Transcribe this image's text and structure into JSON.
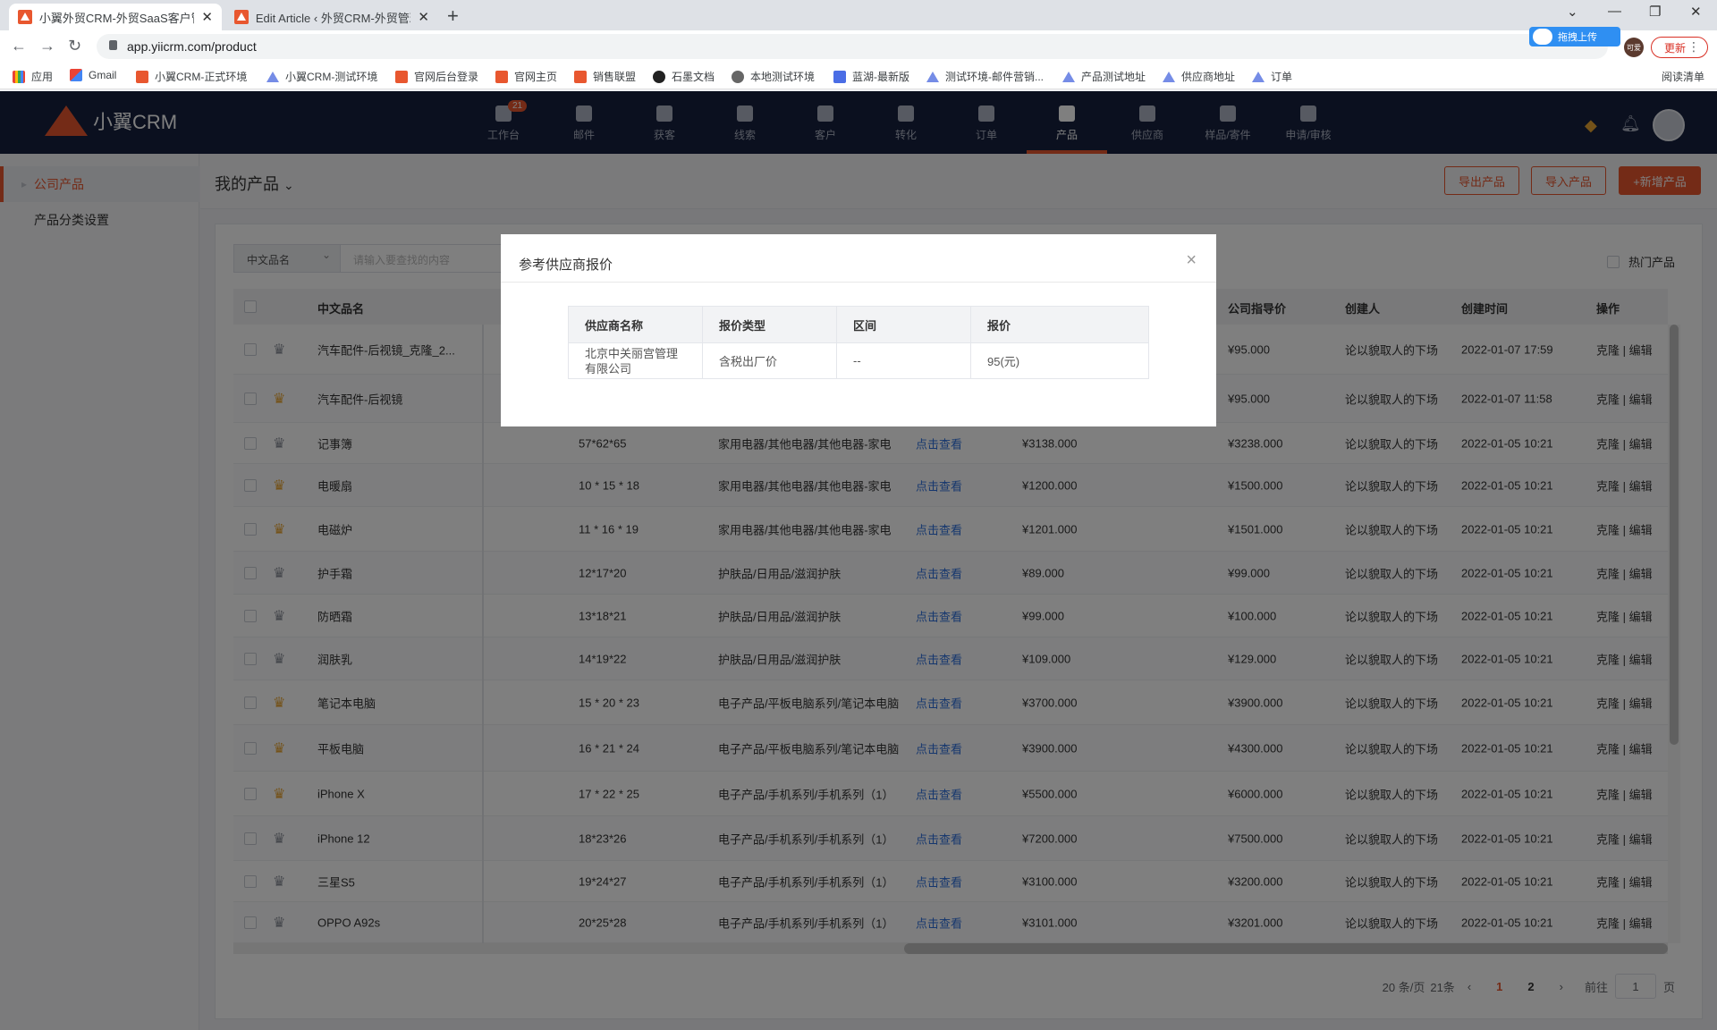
{
  "browser": {
    "tabs": [
      {
        "title": "小翼外贸CRM-外贸SaaS客户管理",
        "active": true
      },
      {
        "title": "Edit Article ‹ 外贸CRM-外贸管理",
        "active": false
      }
    ],
    "url": "app.yiicrm.com/product",
    "upload_label": "拖拽上传",
    "profile_label": "可爱",
    "update_label": "更新",
    "bookmarks": [
      "应用",
      "Gmail",
      "小翼CRM-正式环境",
      "小翼CRM-测试环境",
      "官网后台登录",
      "官网主页",
      "销售联盟",
      "石墨文档",
      "本地测试环境",
      "蓝湖-最新版",
      "测试环境-邮件营销...",
      "产品测试地址",
      "供应商地址",
      "订单"
    ],
    "reading_list": "阅读清单"
  },
  "app": {
    "logo": "小翼CRM",
    "nav": [
      {
        "label": "工作台",
        "badge": "21",
        "active": false
      },
      {
        "label": "邮件",
        "active": false
      },
      {
        "label": "获客",
        "active": false
      },
      {
        "label": "线索",
        "active": false
      },
      {
        "label": "客户",
        "active": false
      },
      {
        "label": "转化",
        "active": false
      },
      {
        "label": "订单",
        "active": false
      },
      {
        "label": "产品",
        "active": true
      },
      {
        "label": "供应商",
        "active": false
      },
      {
        "label": "样品/寄件",
        "active": false
      },
      {
        "label": "申请/审核",
        "active": false
      }
    ]
  },
  "sidebar": {
    "items": [
      {
        "label": "公司产品",
        "active": true
      },
      {
        "label": "产品分类设置",
        "active": false
      }
    ]
  },
  "main": {
    "title": "我的产品",
    "buttons": {
      "export": "导出产品",
      "import": "导入产品",
      "add": "+新增产品"
    },
    "filter": {
      "field": "中文品名",
      "placeholder": "请输入要查找的内容"
    },
    "hot_label": "热门产品"
  },
  "table": {
    "headers": {
      "name": "中文品名",
      "guide_price": "公司指导价",
      "creator": "创建人",
      "created": "创建时间",
      "ops": "操作"
    },
    "rows": [
      {
        "name": "汽车配件-后视镜_克隆_2...",
        "star": "grey",
        "size": "",
        "category": "",
        "quote": "",
        "price": "",
        "guide": "¥95.000",
        "creator": "论以貌取人的下场",
        "created": "2022-01-07 17:59",
        "ops": "克隆 | 编辑"
      },
      {
        "name": "汽车配件-后视镜",
        "star": "gold",
        "size": "",
        "category": "",
        "quote": "",
        "price": "",
        "guide": "¥95.000",
        "creator": "论以貌取人的下场",
        "created": "2022-01-07 11:58",
        "ops": "克隆 | 编辑"
      },
      {
        "name": "记事簿",
        "star": "grey",
        "size": "57*62*65",
        "category": "家用电器/其他电器/其他电器-家电",
        "quote": "点击查看",
        "price": "¥3138.000",
        "guide": "¥3238.000",
        "creator": "论以貌取人的下场",
        "created": "2022-01-05 10:21",
        "ops": "克隆 | 编辑"
      },
      {
        "name": "电暖扇",
        "star": "gold",
        "size": "10 * 15 * 18",
        "category": "家用电器/其他电器/其他电器-家电",
        "quote": "点击查看",
        "price": "¥1200.000",
        "guide": "¥1500.000",
        "creator": "论以貌取人的下场",
        "created": "2022-01-05 10:21",
        "ops": "克隆 | 编辑"
      },
      {
        "name": "电磁炉",
        "star": "gold",
        "size": "11 * 16 * 19",
        "category": "家用电器/其他电器/其他电器-家电",
        "quote": "点击查看",
        "price": "¥1201.000",
        "guide": "¥1501.000",
        "creator": "论以貌取人的下场",
        "created": "2022-01-05 10:21",
        "ops": "克隆 | 编辑"
      },
      {
        "name": "护手霜",
        "star": "grey",
        "size": "12*17*20",
        "category": "护肤品/日用品/滋润护肤",
        "quote": "点击查看",
        "price": "¥89.000",
        "guide": "¥99.000",
        "creator": "论以貌取人的下场",
        "created": "2022-01-05 10:21",
        "ops": "克隆 | 编辑"
      },
      {
        "name": "防晒霜",
        "star": "grey",
        "size": "13*18*21",
        "category": "护肤品/日用品/滋润护肤",
        "quote": "点击查看",
        "price": "¥99.000",
        "guide": "¥100.000",
        "creator": "论以貌取人的下场",
        "created": "2022-01-05 10:21",
        "ops": "克隆 | 编辑"
      },
      {
        "name": "润肤乳",
        "star": "grey",
        "size": "14*19*22",
        "category": "护肤品/日用品/滋润护肤",
        "quote": "点击查看",
        "price": "¥109.000",
        "guide": "¥129.000",
        "creator": "论以貌取人的下场",
        "created": "2022-01-05 10:21",
        "ops": "克隆 | 编辑"
      },
      {
        "name": "笔记本电脑",
        "star": "gold",
        "size": "15 * 20 * 23",
        "category": "电子产品/平板电脑系列/笔记本电脑",
        "quote": "点击查看",
        "price": "¥3700.000",
        "guide": "¥3900.000",
        "creator": "论以貌取人的下场",
        "created": "2022-01-05 10:21",
        "ops": "克隆 | 编辑"
      },
      {
        "name": "平板电脑",
        "star": "gold",
        "size": "16 * 21 * 24",
        "category": "电子产品/平板电脑系列/笔记本电脑",
        "quote": "点击查看",
        "price": "¥3900.000",
        "guide": "¥4300.000",
        "creator": "论以貌取人的下场",
        "created": "2022-01-05 10:21",
        "ops": "克隆 | 编辑"
      },
      {
        "name": "iPhone X",
        "star": "gold",
        "size": "17 * 22 * 25",
        "category": "电子产品/手机系列/手机系列（1）",
        "quote": "点击查看",
        "price": "¥5500.000",
        "guide": "¥6000.000",
        "creator": "论以貌取人的下场",
        "created": "2022-01-05 10:21",
        "ops": "克隆 | 编辑"
      },
      {
        "name": "iPhone 12",
        "star": "grey",
        "size": "18*23*26",
        "category": "电子产品/手机系列/手机系列（1）",
        "quote": "点击查看",
        "price": "¥7200.000",
        "guide": "¥7500.000",
        "creator": "论以貌取人的下场",
        "created": "2022-01-05 10:21",
        "ops": "克隆 | 编辑"
      },
      {
        "name": "三星S5",
        "star": "grey",
        "size": "19*24*27",
        "category": "电子产品/手机系列/手机系列（1）",
        "quote": "点击查看",
        "price": "¥3100.000",
        "guide": "¥3200.000",
        "creator": "论以貌取人的下场",
        "created": "2022-01-05 10:21",
        "ops": "克隆 | 编辑"
      },
      {
        "name": "OPPO A92s",
        "star": "grey",
        "size": "20*25*28",
        "category": "电子产品/手机系列/手机系列（1）",
        "quote": "点击查看",
        "price": "¥3101.000",
        "guide": "¥3201.000",
        "creator": "论以貌取人的下场",
        "created": "2022-01-05 10:21",
        "ops": "克隆 | 编辑"
      }
    ]
  },
  "pagination": {
    "per_page": "20 条/页",
    "total": "21条",
    "pages": [
      "1",
      "2"
    ],
    "current": "1",
    "goto_label": "前往",
    "goto_value": "1",
    "page_suffix": "页"
  },
  "modal": {
    "title": "参考供应商报价",
    "headers": [
      "供应商名称",
      "报价类型",
      "区间",
      "报价"
    ],
    "rows": [
      [
        "北京中关丽宫管理有限公司",
        "含税出厂价",
        "--",
        "95(元)"
      ]
    ]
  },
  "colors": {
    "accent": "#e8572f",
    "header_bg": "#16213e",
    "link": "#2d6fdd"
  }
}
